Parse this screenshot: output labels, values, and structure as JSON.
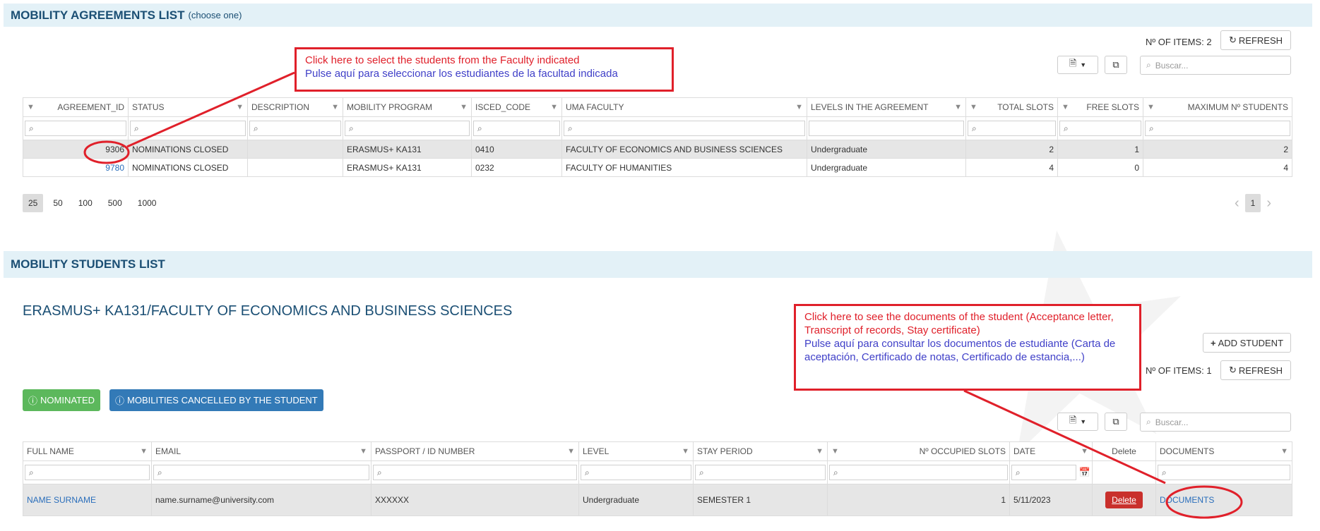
{
  "agreements": {
    "title": "MOBILITY AGREEMENTS LIST",
    "subtitle": "(choose one)",
    "items_count": "Nº OF ITEMS: 2",
    "refresh_label": "REFRESH",
    "search_placeholder": "Buscar...",
    "columns": [
      "AGREEMENT_ID",
      "STATUS",
      "DESCRIPTION",
      "MOBILITY PROGRAM",
      "ISCED_CODE",
      "UMA FACULTY",
      "LEVELS IN THE AGREEMENT",
      "TOTAL SLOTS",
      "FREE SLOTS",
      "MAXIMUM Nº STUDENTS"
    ],
    "rows": [
      {
        "id": "9306",
        "status": "NOMINATIONS CLOSED",
        "description": "",
        "program": "ERASMUS+ KA131",
        "isced": "0410",
        "faculty": "FACULTY OF ECONOMICS AND BUSINESS SCIENCES",
        "levels": "Undergraduate",
        "total": "2",
        "free": "1",
        "max": "2"
      },
      {
        "id": "9780",
        "status": "NOMINATIONS CLOSED",
        "description": "",
        "program": "ERASMUS+ KA131",
        "isced": "0232",
        "faculty": "FACULTY OF HUMANITIES",
        "levels": "Undergraduate",
        "total": "4",
        "free": "0",
        "max": "4"
      }
    ],
    "page_sizes": [
      "25",
      "50",
      "100",
      "500",
      "1000"
    ],
    "current_page": "1"
  },
  "callout_agreements": {
    "en": "Click here to select the students from the Faculty indicated",
    "es": "Pulse aquí para seleccionar los estudiantes de la facultad indicada"
  },
  "students": {
    "title": "MOBILITY STUDENTS LIST",
    "heading": "ERASMUS+ KA131/FACULTY OF ECONOMICS AND BUSINESS SCIENCES",
    "add_student_label": "ADD STUDENT",
    "items_count": "Nº OF ITEMS: 1",
    "refresh_label": "REFRESH",
    "search_placeholder": "Buscar...",
    "nominated_label": "NOMINATED",
    "cancelled_label": "MOBILITIES CANCELLED BY THE STUDENT",
    "columns": [
      "FULL NAME",
      "EMAIL",
      "PASSPORT / ID NUMBER",
      "LEVEL",
      "STAY PERIOD",
      "Nº OCCUPIED SLOTS",
      "DATE",
      "Delete",
      "DOCUMENTS"
    ],
    "rows": [
      {
        "name": "NAME SURNAME",
        "email": "name.surname@university.com",
        "passport": "XXXXXX",
        "level": "Undergraduate",
        "stay": "SEMESTER 1",
        "slots": "1",
        "date": "5/11/2023",
        "delete": "Delete",
        "documents": "DOCUMENTS"
      }
    ]
  },
  "callout_students": {
    "en": "Click here to see the documents of the student (Acceptance letter, Transcript of records, Stay certificate)",
    "es": "Pulse aquí para consultar los documentos de estudiante (Carta de aceptación, Certificado de notas, Certificado de estancia,...)"
  },
  "colors": {
    "section_bg": "#e3f1f7",
    "section_text": "#1b4f74",
    "nominated": "#5cb85c",
    "cancelled": "#337ab7",
    "delete": "#c9302c",
    "annotation": "#e0202a",
    "annotation_es": "#4040c8"
  },
  "icons": {
    "refresh": "refresh-icon",
    "export": "export-icon",
    "columns": "columns-icon",
    "search": "search-icon",
    "filter": "filter-icon",
    "info": "info-icon",
    "plus": "plus-icon",
    "calendar": "calendar-icon",
    "chevron_left": "chevron-left-icon",
    "chevron_right": "chevron-right-icon"
  }
}
